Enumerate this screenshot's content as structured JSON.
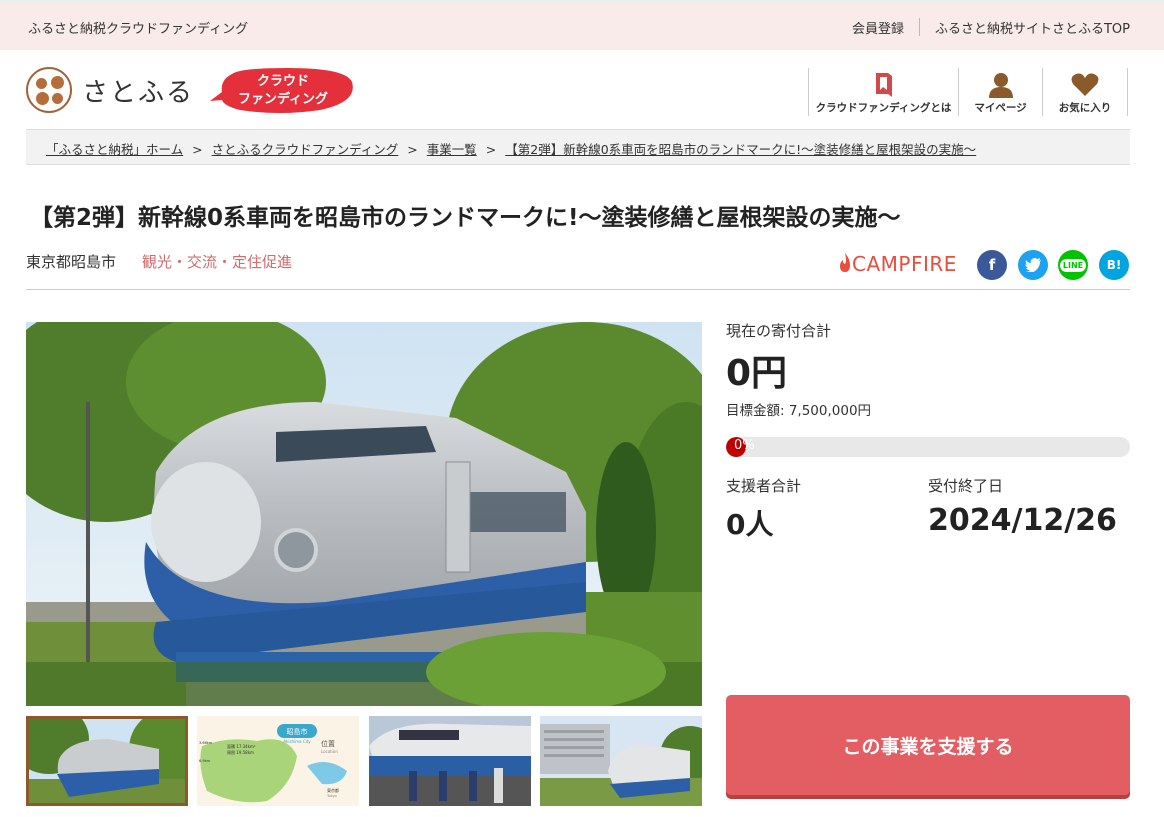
{
  "topbar": {
    "site_label": "ふるさと納税クラウドファンディング",
    "register": "会員登録",
    "top_link": "ふるさと納税サイトさとふるTOP"
  },
  "logo": {
    "text": "さとふる",
    "badge_line1": "クラウド",
    "badge_line2": "ファンディング"
  },
  "nav": [
    {
      "label": "クラウドファンディングとは",
      "icon": "book-icon"
    },
    {
      "label": "マイページ",
      "icon": "user-icon"
    },
    {
      "label": "お気に入り",
      "icon": "heart-icon"
    }
  ],
  "breadcrumb": [
    "「ふるさと納税」ホーム",
    "さとふるクラウドファンディング",
    "事業一覧",
    "【第2弾】新幹線0系車両を昭島市のランドマークに!～塗装修繕と屋根架設の実施～"
  ],
  "project": {
    "title": "【第2弾】新幹線0系車両を昭島市のランドマークに!～塗装修繕と屋根架設の実施～",
    "area": "東京都昭島市",
    "category": "観光・交流・定住促進",
    "partner": "CAMPFIRE"
  },
  "social": [
    {
      "name": "facebook",
      "glyph": "f",
      "color": "#3b5998"
    },
    {
      "name": "twitter",
      "glyph": "t",
      "color": "#1da1f2"
    },
    {
      "name": "line",
      "glyph": "LINE",
      "color": "#00c300"
    },
    {
      "name": "hatena",
      "glyph": "B!",
      "color": "#00a4de"
    }
  ],
  "stats": {
    "current_label": "現在の寄付合計",
    "current_value": "0円",
    "target_label": "目標金額: 7,500,000円",
    "progress_text": "0%",
    "progress_fraction": 0.0,
    "supporters_label": "支援者合計",
    "supporters_value": "0人",
    "deadline_label": "受付終了日",
    "deadline_value": "2024/12/26"
  },
  "cta": {
    "label": "この事業を支援する"
  },
  "map_thumb": {
    "city_label": "昭島市",
    "city_en": "Akishima City",
    "location_label": "位置",
    "location_en": "Location",
    "area_stat": "面積 17.34km²",
    "perimeter_stat": "周囲 19.58km",
    "ns_distance": "3.66km",
    "ew_distance": "6.9km",
    "tokyo_label": "東京都",
    "tokyo_en": "Tokyo"
  },
  "colors": {
    "accent": "#e35e62",
    "progress": "#c00000",
    "category": "#d46a6a",
    "topbar": "#f9ebea"
  }
}
